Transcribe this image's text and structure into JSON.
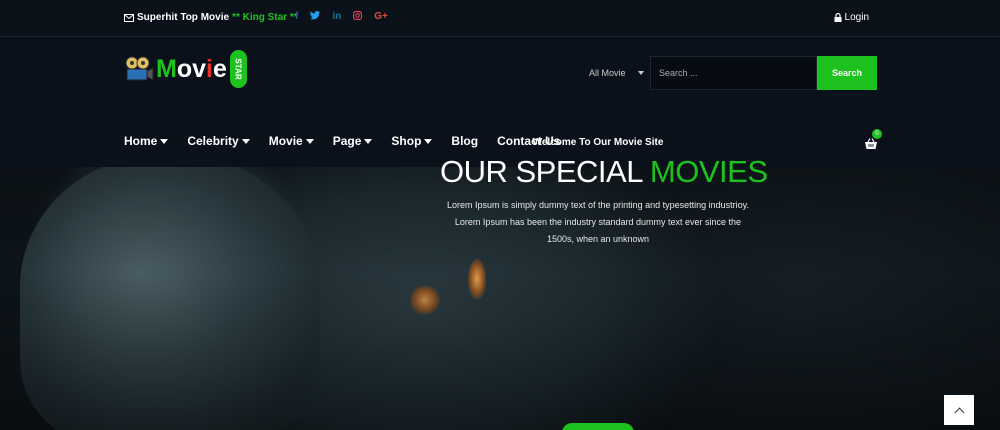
{
  "topbar": {
    "promo_text": "Superhit Top Movie",
    "promo_accent": "** King Star **",
    "social": [
      {
        "icon": "facebook-icon",
        "glyph": "f",
        "color": "#3b5998"
      },
      {
        "icon": "twitter-icon",
        "glyph": "🐦",
        "color": "#1da1f2"
      },
      {
        "icon": "linkedin-icon",
        "glyph": "in",
        "color": "#0e76a8"
      },
      {
        "icon": "instagram-icon",
        "glyph": "◎",
        "color": "#e4405f"
      },
      {
        "icon": "google-plus-icon",
        "glyph": "G+",
        "color": "#dd4b39"
      }
    ],
    "login_label": "Login"
  },
  "logo": {
    "word_a": "M",
    "word_b": "ov",
    "word_c": "i",
    "word_d": "e",
    "pill_text": "STAR"
  },
  "search": {
    "category": "All Movie",
    "placeholder": "Search ...",
    "button_label": "Search"
  },
  "nav": {
    "items": [
      {
        "label": "Home",
        "dropdown": true
      },
      {
        "label": "Celebrity",
        "dropdown": true
      },
      {
        "label": "Movie",
        "dropdown": true
      },
      {
        "label": "Page",
        "dropdown": true
      },
      {
        "label": "Shop",
        "dropdown": true
      },
      {
        "label": "Blog",
        "dropdown": false
      },
      {
        "label": "Contact Us",
        "dropdown": false
      }
    ],
    "cart_count": "0"
  },
  "hero": {
    "kicker": "Welcome To Our Movie Site",
    "title_white": "OUR SPECIAL ",
    "title_green": "MOVIES",
    "body": "Lorem Ipsum is simply dummy text of the printing and typesetting industrioy. Lorem Ipsum has been the industry standard dummy text ever since the 1500s, when an unknown"
  },
  "colors": {
    "accent": "#1ec21e",
    "background": "#0a1018"
  }
}
